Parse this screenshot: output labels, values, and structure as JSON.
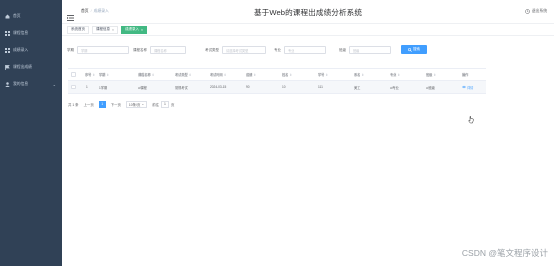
{
  "sidebar": {
    "items": [
      {
        "label": "首页",
        "icon": "home-icon"
      },
      {
        "label": "课程信息",
        "icon": "grid-icon"
      },
      {
        "label": "成绩录入",
        "icon": "grid-icon"
      },
      {
        "label": "课程出成绩",
        "icon": "flag-icon"
      },
      {
        "label": "我的信息",
        "icon": "user-icon",
        "has_arrow": true
      }
    ]
  },
  "header": {
    "breadcrumb": [
      "首页",
      "成绩录入"
    ],
    "title": "基于Web的课程出成绩分析系统",
    "logout": "退出系统"
  },
  "tags": [
    {
      "label": "系统首页",
      "active": false,
      "closable": false
    },
    {
      "label": "课程信息",
      "active": false,
      "closable": true
    },
    {
      "label": "成绩录入",
      "active": true,
      "closable": true
    }
  ],
  "search": {
    "fields": [
      {
        "label": "学期",
        "placeholder": "学期"
      },
      {
        "label": "课程名称",
        "placeholder": "课程名称"
      },
      {
        "label": "考试类型",
        "placeholder": "请选择考试类型"
      },
      {
        "label": "专业",
        "placeholder": "专业"
      },
      {
        "label": "班级",
        "placeholder": "班级"
      }
    ],
    "button": "搜索"
  },
  "table": {
    "columns": [
      "",
      "序号",
      "学期",
      "课程名称",
      "考试类型",
      "考试时间",
      "成绩",
      "姓名",
      "学号",
      "系名",
      "专业",
      "班级",
      "操作"
    ],
    "rows": [
      {
        "index": "1",
        "cells": [
          "1学期",
          "ui课程",
          "常规考试",
          "2024-03-15",
          "90",
          "10",
          "111",
          "美工",
          "ui专业",
          "ui班级"
        ],
        "action": "详情"
      }
    ]
  },
  "pagination": {
    "total": "共 1 条",
    "prev": "上一页",
    "current_page": "1",
    "next": "下一页",
    "page_size": "10条/页",
    "jump_label": "前往",
    "jump_value": "1",
    "page_suffix": "页"
  },
  "watermark": "CSDN @笔文程序设计"
}
